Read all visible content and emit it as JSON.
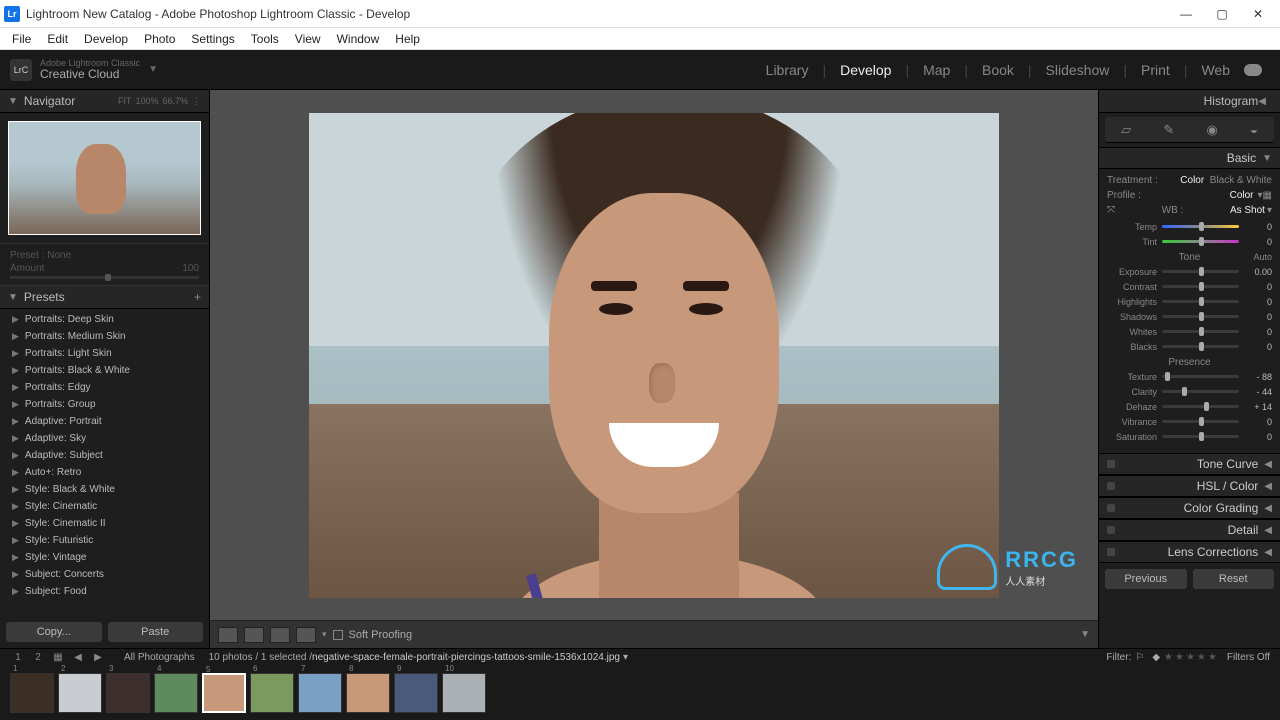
{
  "window": {
    "title": "Lightroom New Catalog - Adobe Photoshop Lightroom Classic - Develop",
    "app_icon_text": "Lr"
  },
  "menubar": [
    "File",
    "Edit",
    "Develop",
    "Photo",
    "Settings",
    "Tools",
    "View",
    "Window",
    "Help"
  ],
  "brand": {
    "badge": "LrC",
    "line1": "Adobe Lightroom Classic",
    "line2": "Creative Cloud"
  },
  "modules": [
    "Library",
    "Develop",
    "Map",
    "Book",
    "Slideshow",
    "Print",
    "Web"
  ],
  "active_module": "Develop",
  "navigator": {
    "title": "Navigator",
    "zoom": [
      "FIT",
      "100%",
      "66.7%"
    ]
  },
  "preset_amount": {
    "preset_label": "Preset :",
    "preset_value": "None",
    "amount_label": "Amount",
    "amount_value": "100"
  },
  "presets": {
    "title": "Presets",
    "items": [
      "Portraits: Deep Skin",
      "Portraits: Medium Skin",
      "Portraits: Light Skin",
      "Portraits: Black & White",
      "Portraits: Edgy",
      "Portraits: Group",
      "Adaptive: Portrait",
      "Adaptive: Sky",
      "Adaptive: Subject",
      "Auto+: Retro",
      "Style: Black & White",
      "Style: Cinematic",
      "Style: Cinematic II",
      "Style: Futuristic",
      "Style: Vintage",
      "Subject: Concerts",
      "Subject: Food"
    ]
  },
  "left_buttons": {
    "copy": "Copy...",
    "paste": "Paste"
  },
  "view_toolbar": {
    "soft_proofing": "Soft Proofing"
  },
  "right": {
    "histogram": "Histogram",
    "basic": {
      "title": "Basic",
      "treatment_label": "Treatment :",
      "color": "Color",
      "bw": "Black & White",
      "profile_label": "Profile :",
      "profile_value": "Color",
      "wb_label": "WB :",
      "wb_value": "As Shot",
      "tone_label": "Tone",
      "auto": "Auto",
      "presence_label": "Presence",
      "sliders": {
        "temp": {
          "label": "Temp",
          "value": "0",
          "pos": 50
        },
        "tint": {
          "label": "Tint",
          "value": "0",
          "pos": 50
        },
        "exposure": {
          "label": "Exposure",
          "value": "0.00",
          "pos": 50
        },
        "contrast": {
          "label": "Contrast",
          "value": "0",
          "pos": 50
        },
        "highlights": {
          "label": "Highlights",
          "value": "0",
          "pos": 50
        },
        "shadows": {
          "label": "Shadows",
          "value": "0",
          "pos": 50
        },
        "whites": {
          "label": "Whites",
          "value": "0",
          "pos": 50
        },
        "blacks": {
          "label": "Blacks",
          "value": "0",
          "pos": 50
        },
        "texture": {
          "label": "Texture",
          "value": "- 88",
          "pos": 6
        },
        "clarity": {
          "label": "Clarity",
          "value": "- 44",
          "pos": 28
        },
        "dehaze": {
          "label": "Dehaze",
          "value": "+ 14",
          "pos": 57
        },
        "vibrance": {
          "label": "Vibrance",
          "value": "0",
          "pos": 50
        },
        "saturation": {
          "label": "Saturation",
          "value": "0",
          "pos": 50
        }
      }
    },
    "sections": [
      "Tone Curve",
      "HSL / Color",
      "Color Grading",
      "Detail",
      "Lens Corrections"
    ],
    "buttons": {
      "previous": "Previous",
      "reset": "Reset"
    }
  },
  "filmstrip_meta": {
    "grid_nums": [
      "1",
      "2"
    ],
    "source": "All Photographs",
    "count": "10 photos / 1 selected /",
    "filename": "negative-space-female-portrait-piercings-tattoos-smile-1536x1024.jpg",
    "filter_label": "Filter:",
    "filters_off": "Filters Off"
  },
  "thumb_count": 10,
  "selected_thumb": 5,
  "watermark": {
    "title": "RRCG",
    "sub": "人人素材"
  }
}
